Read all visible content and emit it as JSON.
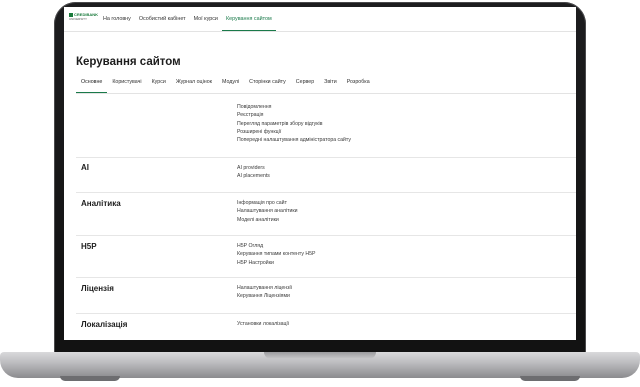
{
  "nav": {
    "logo_text": "CREDIBANK",
    "logo_subtext": "UNIVERSITY",
    "items": [
      {
        "label": "На головну"
      },
      {
        "label": "Особистий кабінет"
      },
      {
        "label": "Мої курси"
      },
      {
        "label": "Керування сайтом",
        "active": true
      }
    ]
  },
  "page": {
    "title": "Керування сайтом"
  },
  "tabs": [
    {
      "label": "Основне",
      "active": true
    },
    {
      "label": "Користувачі"
    },
    {
      "label": "Курси"
    },
    {
      "label": "Журнал оцінок"
    },
    {
      "label": "Модулі"
    },
    {
      "label": "Сторінки сайту"
    },
    {
      "label": "Сервер"
    },
    {
      "label": "Звіти"
    },
    {
      "label": "Розробка"
    }
  ],
  "sections": [
    {
      "title": "",
      "links": [
        "Повідомлення",
        "Реєстрація",
        "Перегляд параметрів збору відгуків",
        "Розширені функції",
        "Попередні налаштування адміністратора сайту"
      ]
    },
    {
      "title": "AI",
      "links": [
        "AI providers",
        "AI placements"
      ]
    },
    {
      "title": "Аналітика",
      "links": [
        "Інформація про сайт",
        "Налаштування аналітики",
        "Моделі аналітики"
      ]
    },
    {
      "title": "H5P",
      "links": [
        "H5P Огляд",
        "Керування типами контенту H5P",
        "H5P Настройки"
      ]
    },
    {
      "title": "Ліцензія",
      "links": [
        "Налаштування ліцензії",
        "Керування Ліцензіями"
      ]
    },
    {
      "title": "Локалізація",
      "links": [
        "Установки локалізації"
      ]
    }
  ],
  "colors": {
    "accent": "#1a7a4a",
    "brand": "#1a7a3c",
    "bezel": "#111111",
    "chassis": "#bdbdc0"
  }
}
